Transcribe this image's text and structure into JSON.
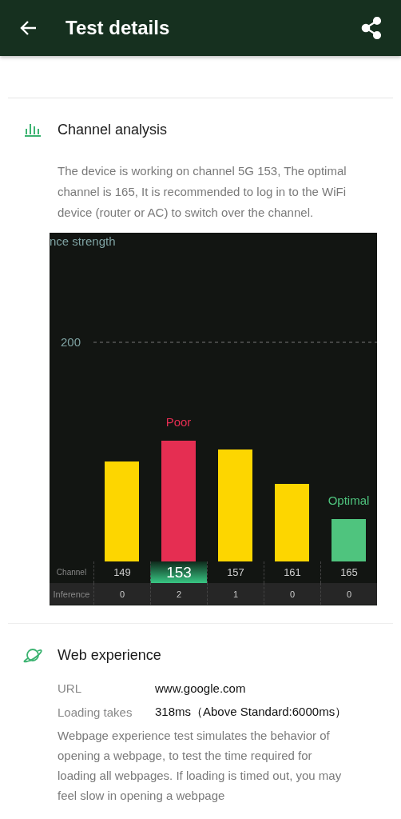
{
  "app_bar": {
    "title": "Test details"
  },
  "channel_analysis": {
    "title": "Channel analysis",
    "description": "The device is working on channel 5G 153, The optimal channel is 165, It is recommended to log in to the WiFi device (router or AC) to switch over the channel.",
    "chart": {
      "ylabel": "nce strength",
      "ytick": "200",
      "row_labels": [
        "Channel",
        "Inference"
      ],
      "channels": [
        {
          "channel": "149",
          "inference": "0",
          "color": "#fdd600",
          "selected": false
        },
        {
          "channel": "153",
          "inference": "2",
          "color": "#e52e52",
          "selected": true,
          "tag": "Poor"
        },
        {
          "channel": "157",
          "inference": "1",
          "color": "#fdd600",
          "selected": false
        },
        {
          "channel": "161",
          "inference": "0",
          "color": "#fdd600",
          "selected": false
        },
        {
          "channel": "165",
          "inference": "0",
          "color": "#4fc47e",
          "selected": false,
          "tag": "Optimal"
        }
      ]
    }
  },
  "web_experience": {
    "title": "Web experience",
    "rows": [
      {
        "label": "URL",
        "value": "www.google.com"
      },
      {
        "label": "Loading takes",
        "value": "318ms（Above Standard:6000ms）"
      }
    ],
    "description": "Webpage experience test simulates the behavior of opening a webpage, to test the time required for loading all webpages. If loading is timed out, you may feel slow in opening a webpage"
  }
}
